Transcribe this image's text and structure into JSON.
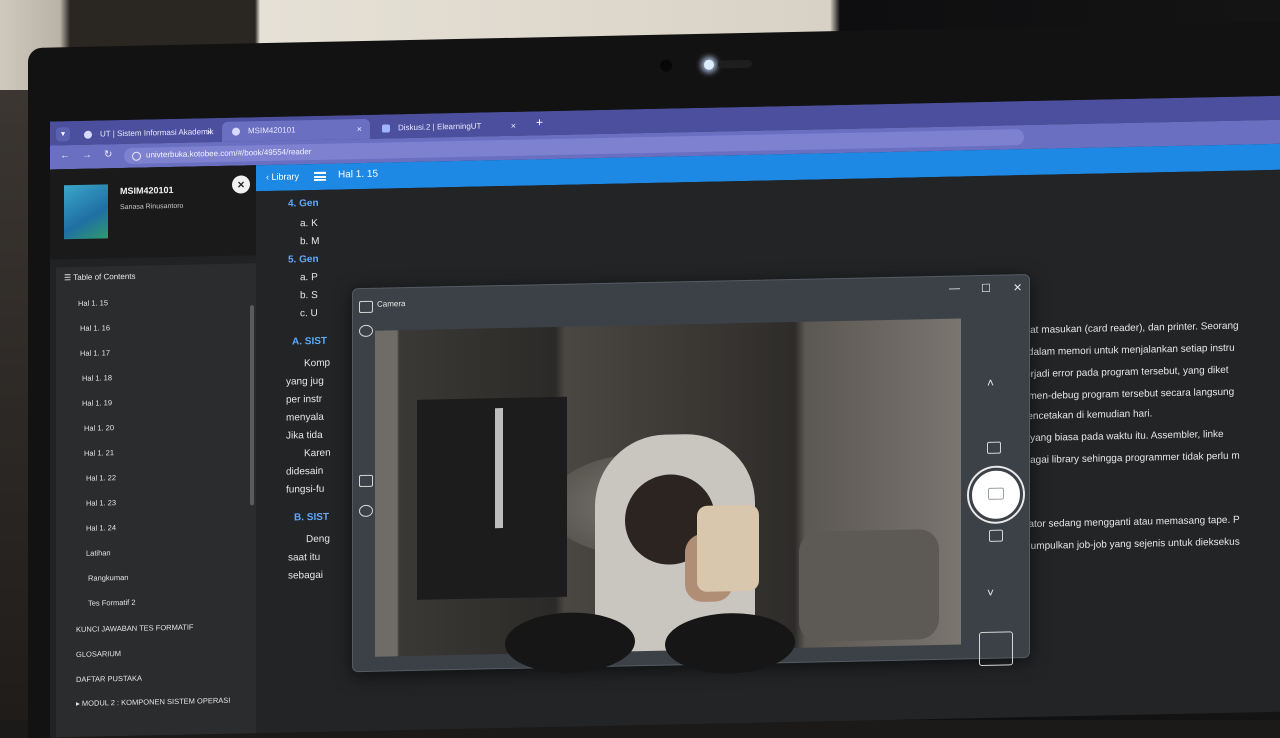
{
  "browser": {
    "tabs": [
      {
        "label": "UT | Sistem Informasi Akademik"
      },
      {
        "label": "MSIM420101"
      },
      {
        "label": "Diskusi.2 | ElearningUT"
      }
    ],
    "tab_close": "×",
    "new_tab": "+",
    "url": "univterbuka.kotobee.com/#/book/49554/reader"
  },
  "book": {
    "code": "MSIM420101",
    "author": "Sanasa Rinusantoro",
    "close": "×"
  },
  "toc": {
    "title": "Table of Contents",
    "items": [
      "Hal 1. 15",
      "Hal 1. 16",
      "Hal 1. 17",
      "Hal 1. 18",
      "Hal 1. 19",
      "Hal 1. 20",
      "Hal 1. 21",
      "Hal 1. 22",
      "Hal 1. 23",
      "Hal 1. 24",
      "Latihan",
      "Rangkuman",
      "Tes Formatif 2",
      "KUNCI JAWABAN TES FORMATIF",
      "GLOSARIUM",
      "DAFTAR PUSTAKA",
      "MODUL 2 : KOMPONEN SISTEM OPERASI"
    ]
  },
  "reader": {
    "library": "Library",
    "page": "Hal 1. 15"
  },
  "content": {
    "lines": [
      "4. Gen",
      "a. K",
      "b. M",
      "5. Gen",
      "a. P",
      "b. S",
      "c. U",
      "A. SIST",
      "Komp",
      "yang jug",
      "per instr",
      "menyala",
      "Jika tida",
      "Karen",
      "didesain",
      "fungsi-fu",
      "B. SIST",
      "Deng",
      "saat itu",
      "sebagai"
    ],
    "right_lines": [
      "ngkat masukan (card reader), dan printer. Seorang",
      "an dalam memori untuk menjalankan setiap instru",
      "a terjadi error pada program tersebut, yang diket",
      "rta men-debug program tersebut secara langsung",
      "k pencetakan di kemudian hari.",
      "hal yang biasa pada waktu itu. Assembler, linke",
      "sebagai library sehingga programmer tidak perlu m",
      "perator sedang mengganti atau memasang tape. P",
      "engumpulkan job-job yang sejenis untuk dieksekus"
    ]
  },
  "camera": {
    "title": "Camera",
    "minimize": "—",
    "maximize": "☐",
    "close": "✕",
    "up": "˄",
    "down": "˅"
  }
}
